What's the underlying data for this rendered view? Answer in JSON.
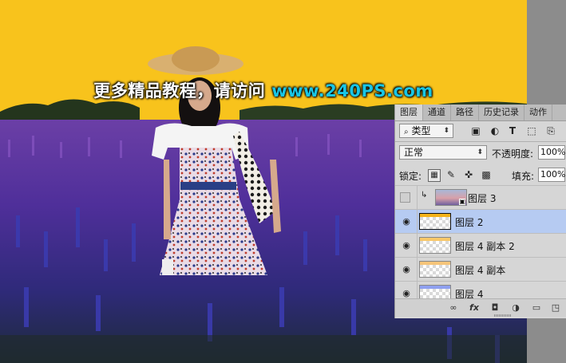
{
  "watermark": {
    "text": "更多精品教程，请访问",
    "url": "www.240PS.com"
  },
  "layers_panel": {
    "tabs": [
      {
        "label": "图层",
        "active": true
      },
      {
        "label": "通道",
        "active": false
      },
      {
        "label": "路径",
        "active": false
      },
      {
        "label": "历史记录",
        "active": false
      },
      {
        "label": "动作",
        "active": false
      }
    ],
    "filter": {
      "icon": "search-icon",
      "value": "类型"
    },
    "filter_icons": [
      "image-filter-icon",
      "adjustment-filter-icon",
      "type-filter-icon",
      "shape-filter-icon",
      "smart-object-filter-icon"
    ],
    "blend_mode": "正常",
    "opacity_label": "不透明度:",
    "opacity_value": "100%",
    "lock_label": "锁定:",
    "lock_icons": [
      "lock-transparent-icon",
      "lock-image-icon",
      "lock-position-icon",
      "lock-all-icon"
    ],
    "fill_label": "填充:",
    "fill_value": "100%",
    "layers": [
      {
        "name": "图层 3",
        "visible": false,
        "clipped": true,
        "selected": false,
        "thumb": "photo",
        "band_color": ""
      },
      {
        "name": "图层 2",
        "visible": true,
        "clipped": false,
        "selected": true,
        "thumb": "band",
        "band_color": "#f5b21a"
      },
      {
        "name": "图层 4 副本 2",
        "visible": true,
        "clipped": false,
        "selected": false,
        "thumb": "band",
        "band_color": "#f8c86a"
      },
      {
        "name": "图层 4 副本",
        "visible": true,
        "clipped": false,
        "selected": false,
        "thumb": "band",
        "band_color": "#f6c57a"
      },
      {
        "name": "图层 4",
        "visible": true,
        "clipped": false,
        "selected": false,
        "thumb": "band",
        "band_color": "#8fa0f0"
      }
    ],
    "footer_icons": [
      "link-icon",
      "fx-icon",
      "mask-icon",
      "adjustment-icon",
      "group-icon",
      "new-layer-icon",
      "trash-icon"
    ],
    "footer_fx_label": "fx"
  },
  "colors": {
    "sky": "#f8c31c",
    "selected_row": "#b6cbf2",
    "panel_bg": "#d6d6d6"
  }
}
